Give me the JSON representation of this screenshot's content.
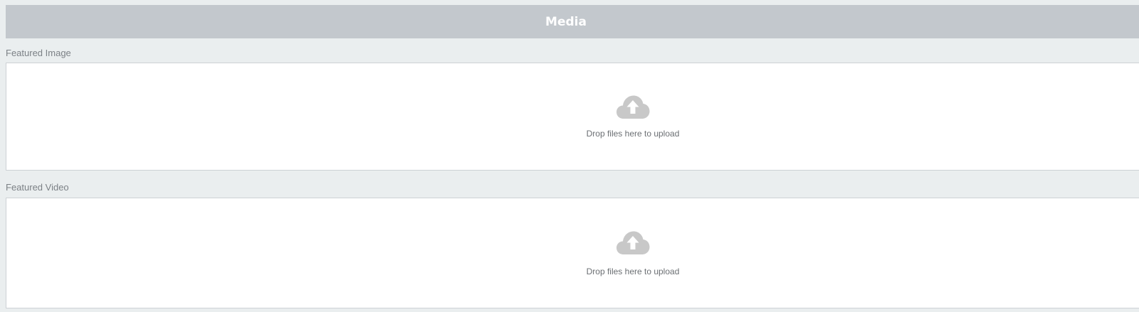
{
  "panel": {
    "title": "Media"
  },
  "fields": [
    {
      "label": "Featured Image",
      "dropzone_message": "Drop files here to upload",
      "icon": "cloud-upload-icon"
    },
    {
      "label": "Featured Video",
      "dropzone_message": "Drop files here to upload",
      "icon": "cloud-upload-icon"
    }
  ],
  "colors": {
    "header_bg": "#c3c8cd",
    "page_bg": "#eaeeef",
    "icon": "#c8c8c8"
  }
}
